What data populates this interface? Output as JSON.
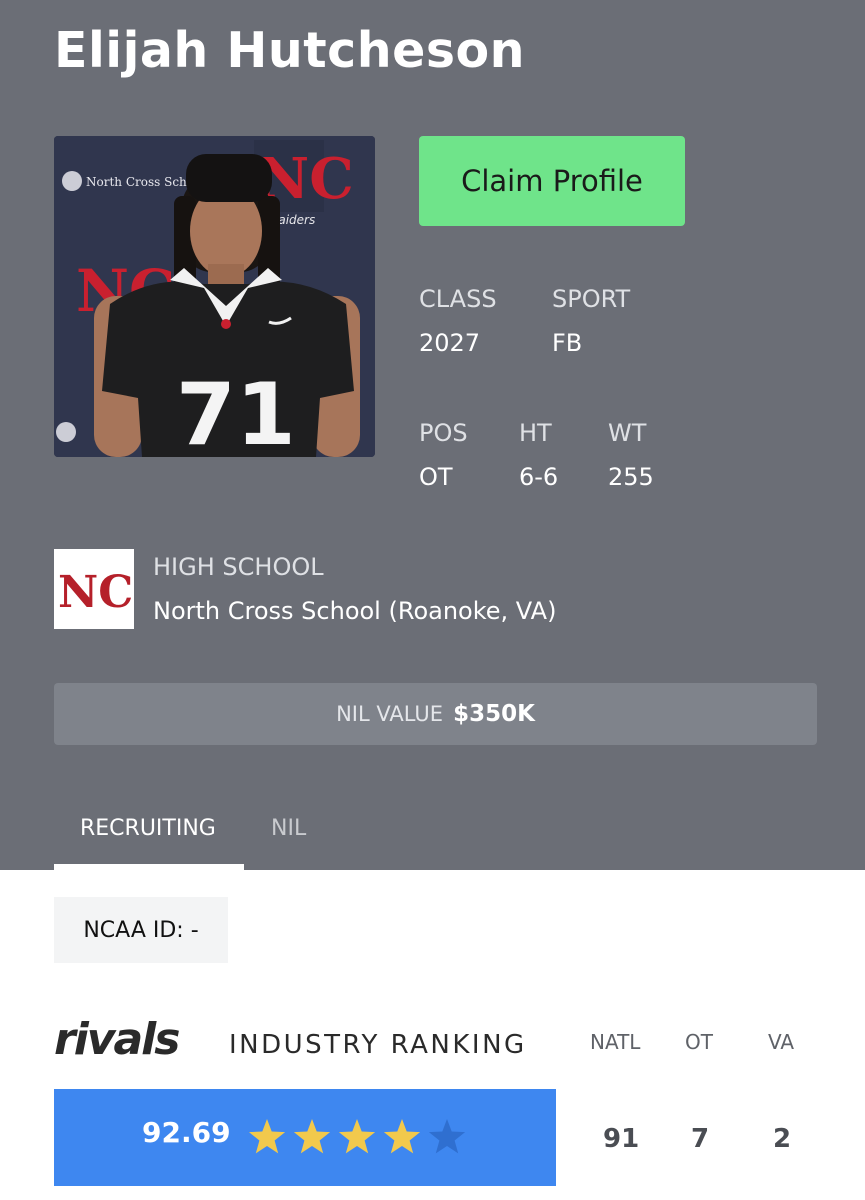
{
  "player": {
    "name": "Elijah Hutcheson",
    "jersey_number": "71",
    "photo_text_school": "North Cross School",
    "photo_text_raiders": "Raiders"
  },
  "claim_button": "Claim Profile",
  "details": {
    "class_label": "CLASS",
    "class_value": "2027",
    "sport_label": "SPORT",
    "sport_value": "FB",
    "pos_label": "POS",
    "pos_value": "OT",
    "ht_label": "HT",
    "ht_value": "6-6",
    "wt_label": "WT",
    "wt_value": "255"
  },
  "school": {
    "label": "HIGH SCHOOL",
    "value": "North Cross School (Roanoke, VA)",
    "logo_text": "NC",
    "logo_color": "#b5202a"
  },
  "nil": {
    "label": "NIL VALUE",
    "amount": "$350K"
  },
  "tabs": [
    {
      "label": "RECRUITING",
      "active": true
    },
    {
      "label": "NIL",
      "active": false
    }
  ],
  "ncaa_id": "NCAA ID:  -",
  "ranking": {
    "brand": "rivals",
    "title": "INDUSTRY RANKING",
    "columns": [
      "NATL",
      "OT",
      "VA"
    ],
    "rating": "92.69",
    "stars": 4,
    "max_stars": 5,
    "values": [
      "91",
      "7",
      "2"
    ]
  },
  "colors": {
    "header_bg": "#6b6e76",
    "claim_button": "#6fe48a",
    "rating_bar": "#3e87f0",
    "star_filled": "#f2c94c",
    "star_empty": "#2f6fd0"
  }
}
